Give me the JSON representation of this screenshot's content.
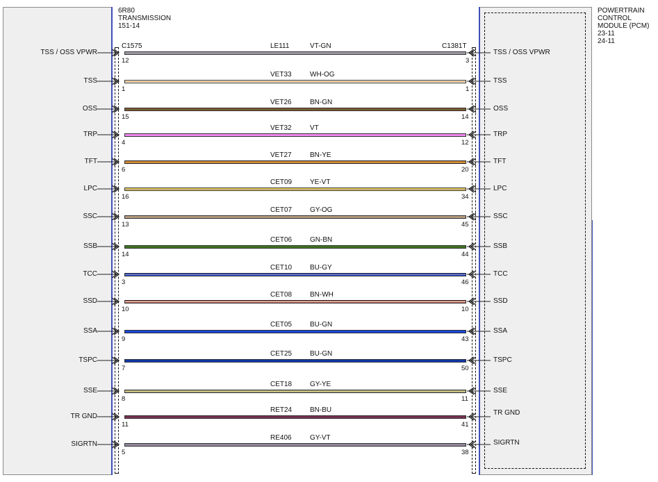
{
  "left_module": {
    "lines": [
      "6R80",
      "TRANSMISSION",
      "151-14"
    ],
    "connector": "C1575"
  },
  "right_module": {
    "lines": [
      "POWERTRAIN",
      "CONTROL",
      "MODULE (PCM)",
      "23-11",
      "24-11"
    ],
    "connector": "C1381T"
  },
  "circuits": [
    {
      "left_label": "TSS / OSS VPWR",
      "right_label": "TSS / OSS VPWR",
      "left_pin": "12",
      "right_pin": "3",
      "circuit": "LE111",
      "color_code": "VT-GN",
      "color": "#c79ad6",
      "stripe": "#5aa05a"
    },
    {
      "left_label": "TSS",
      "right_label": "TSS",
      "left_pin": "1",
      "right_pin": "1",
      "circuit": "VET33",
      "color_code": "WH-OG",
      "color": "#fbfbf0",
      "stripe": "#e8a050"
    },
    {
      "left_label": "OSS",
      "right_label": "OSS",
      "left_pin": "15",
      "right_pin": "14",
      "circuit": "VET26",
      "color_code": "BN-GN",
      "color": "#9a4a2a",
      "stripe": "#3d7a3d"
    },
    {
      "left_label": "TRP",
      "right_label": "TRP",
      "left_pin": "4",
      "right_pin": "12",
      "circuit": "VET32",
      "color_code": "VT",
      "color": "#ee88ee",
      "stripe": "#ee88ee"
    },
    {
      "left_label": "TFT",
      "right_label": "TFT",
      "left_pin": "6",
      "right_pin": "20",
      "circuit": "VET27",
      "color_code": "BN-YE",
      "color": "#b8652f",
      "stripe": "#e8c040"
    },
    {
      "left_label": "LPC",
      "right_label": "LPC",
      "left_pin": "16",
      "right_pin": "34",
      "circuit": "CET09",
      "color_code": "YE-VT",
      "color": "#f2ec3a",
      "stripe": "#b070c0"
    },
    {
      "left_label": "SSC",
      "right_label": "SSC",
      "left_pin": "13",
      "right_pin": "45",
      "circuit": "CET07",
      "color_code": "GY-OG",
      "color": "#9a9a9a",
      "stripe": "#e09a50"
    },
    {
      "left_label": "SSB",
      "right_label": "SSB",
      "left_pin": "14",
      "right_pin": "44",
      "circuit": "CET06",
      "color_code": "GN-BN",
      "color": "#1f8a1f",
      "stripe": "#7a4a2a"
    },
    {
      "left_label": "TCC",
      "right_label": "TCC",
      "left_pin": "3",
      "right_pin": "46",
      "circuit": "CET10",
      "color_code": "BU-GY",
      "color": "#1a3fe0",
      "stripe": "#9a9a9a"
    },
    {
      "left_label": "SSD",
      "right_label": "SSD",
      "left_pin": "10",
      "right_pin": "10",
      "circuit": "CET08",
      "color_code": "BN-WH",
      "color": "#b04f45",
      "stripe": "#f0e8e0"
    },
    {
      "left_label": "SSA",
      "right_label": "SSA",
      "left_pin": "9",
      "right_pin": "43",
      "circuit": "CET05",
      "color_code": "BU-GN",
      "color": "#1a46d8",
      "stripe": "#1a46d8"
    },
    {
      "left_label": "TSPC",
      "right_label": "TSPC",
      "left_pin": "7",
      "right_pin": "50",
      "circuit": "CET25",
      "color_code": "BU-GN",
      "color": "#1640c0",
      "stripe": "#0a2a80"
    },
    {
      "left_label": "SSE",
      "right_label": "SSE",
      "left_pin": "8",
      "right_pin": "11",
      "circuit": "CET18",
      "color_code": "GY-YE",
      "color": "#a8a48a",
      "stripe": "#d8d070"
    },
    {
      "left_label": "TR GND",
      "right_label": "TR GND",
      "left_pin": "11",
      "right_pin": "41",
      "circuit": "RET24",
      "color_code": "BN-BU",
      "color": "#8a2a3a",
      "stripe": "#5a3a7a"
    },
    {
      "left_label": "SIGRTN",
      "right_label": "SIGRTN",
      "left_pin": "5",
      "right_pin": "38",
      "circuit": "RE406",
      "color_code": "GY-VT",
      "color": "#8c8c96",
      "stripe": "#a080b0"
    }
  ]
}
